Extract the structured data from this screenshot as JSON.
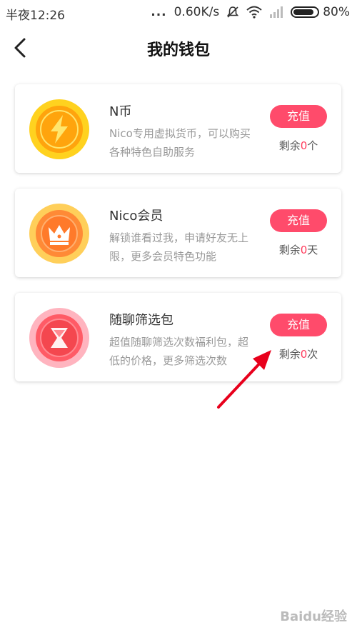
{
  "status": {
    "time": "半夜12:26",
    "dots": "...",
    "speed": "0.60K/s",
    "battery": "80%"
  },
  "header": {
    "title": "我的钱包"
  },
  "cards": [
    {
      "name": "N币",
      "desc": "Nico专用虚拟货币，可以购买各种特色自助服务",
      "button": "充值",
      "remain_prefix": "剩余",
      "remain_value": "0",
      "remain_unit": "个",
      "icon": "lightning-coin-icon"
    },
    {
      "name": "Nico会员",
      "desc": "解锁谁看过我，申请好友无上限，更多会员特色功能",
      "button": "充值",
      "remain_prefix": "剩余",
      "remain_value": "0",
      "remain_unit": "天",
      "icon": "crown-icon"
    },
    {
      "name": "随聊筛选包",
      "desc": "超值随聊筛选次数福利包，超低的价格，更多筛选次数",
      "button": "充值",
      "remain_prefix": "剩余",
      "remain_value": "0",
      "remain_unit": "次",
      "icon": "hourglass-icon"
    }
  ],
  "watermark": "Baidu经验",
  "colors": {
    "accent": "#ff4b6b",
    "remain_number": "#ff3b5c",
    "annotation_arrow": "#e8001c"
  }
}
